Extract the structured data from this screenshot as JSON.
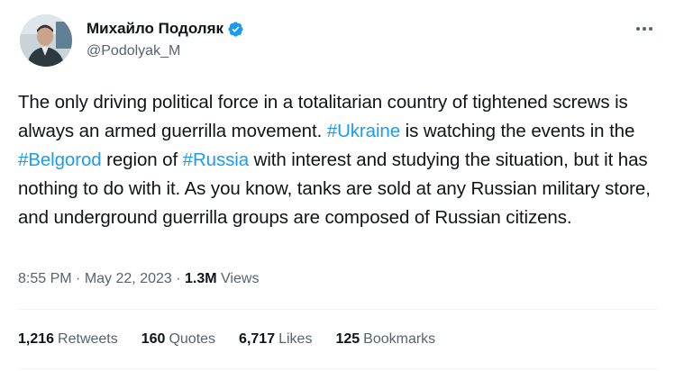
{
  "author": {
    "name": "Михайло Подоляк",
    "handle": "@Podolyak_M",
    "verified_color": "#1d9bf0"
  },
  "tweet": {
    "segments": [
      {
        "text": "The only driving political force in a totalitarian country of tightened screws is always an armed guerrilla movement. ",
        "type": "text"
      },
      {
        "text": "#Ukraine",
        "type": "hashtag"
      },
      {
        "text": " is watching the events in the ",
        "type": "text"
      },
      {
        "text": "#Belgorod",
        "type": "hashtag"
      },
      {
        "text": " region of ",
        "type": "text"
      },
      {
        "text": "#Russia",
        "type": "hashtag"
      },
      {
        "text": " with interest and studying the situation, but it has nothing to do with it. As you know, tanks are sold at any Russian military store, and underground guerrilla groups are composed of Russian citizens.",
        "type": "text"
      }
    ],
    "time": "8:55 PM",
    "separator": "·",
    "date": "May 22, 2023",
    "views_count": "1.3M",
    "views_label": "Views"
  },
  "stats": {
    "retweets_count": "1,216",
    "retweets_label": "Retweets",
    "quotes_count": "160",
    "quotes_label": "Quotes",
    "likes_count": "6,717",
    "likes_label": "Likes",
    "bookmarks_count": "125",
    "bookmarks_label": "Bookmarks"
  },
  "colors": {
    "link": "#1d9bf0",
    "secondary_text": "#536471",
    "primary_text": "#0f1419",
    "divider": "#eff3f4"
  },
  "icons": {
    "verified": "verified-badge-icon",
    "more": "more-horizontal-icon"
  }
}
